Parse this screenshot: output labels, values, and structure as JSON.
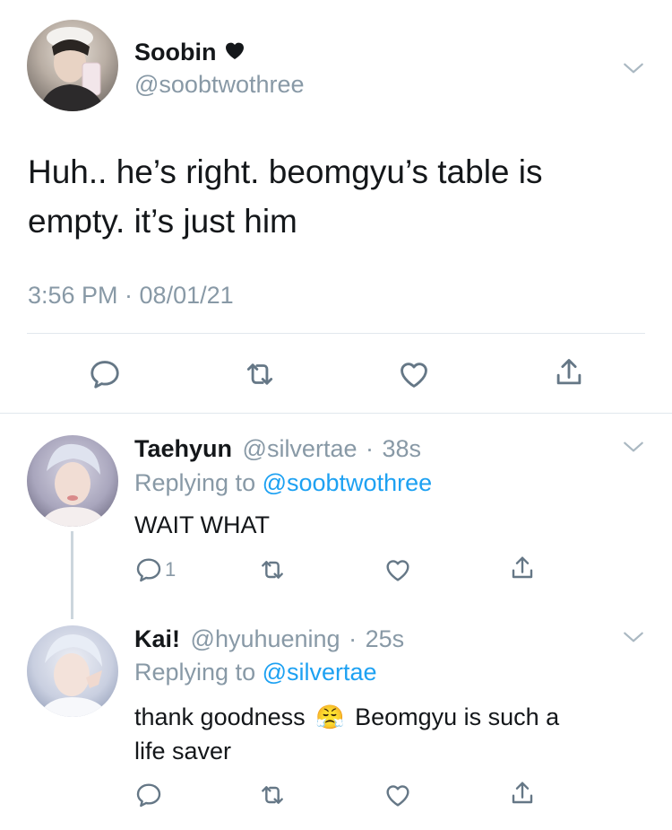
{
  "main_tweet": {
    "display_name": "Soobin",
    "handle": "@soobtwothree",
    "text": "Huh.. he’s right. beomgyu’s table is empty. it’s just him",
    "text_line1": "Huh.. he’s right. beomgyu’s table is",
    "text_line2": "empty. it’s just him",
    "time": "3:56 PM",
    "date": "08/01/21",
    "timestamp": "3:56 PM · 08/01/21"
  },
  "replies": [
    {
      "display_name": "Taehyun",
      "handle": "@silvertae",
      "age": "38s",
      "replying_prefix": "Replying to ",
      "replying_to": "@soobtwothree",
      "text": "WAIT WHAT",
      "reply_count": "1"
    },
    {
      "display_name": "Kai!",
      "handle": "@hyuhuening",
      "age": "25s",
      "replying_prefix": "Replying to ",
      "replying_to": "@silvertae",
      "text_line1_a": "thank goodness",
      "emoji": "😤",
      "text_line1_b": "Beomgyu is such a",
      "text_line2": "life saver"
    }
  ],
  "icons": [
    "heart-icon",
    "chevron-down-icon",
    "reply-icon",
    "retweet-icon",
    "like-icon",
    "share-icon"
  ],
  "colors": {
    "link": "#1da1f2",
    "muted": "#8899a6",
    "text": "#14171a",
    "divider": "#e1e8ed"
  }
}
